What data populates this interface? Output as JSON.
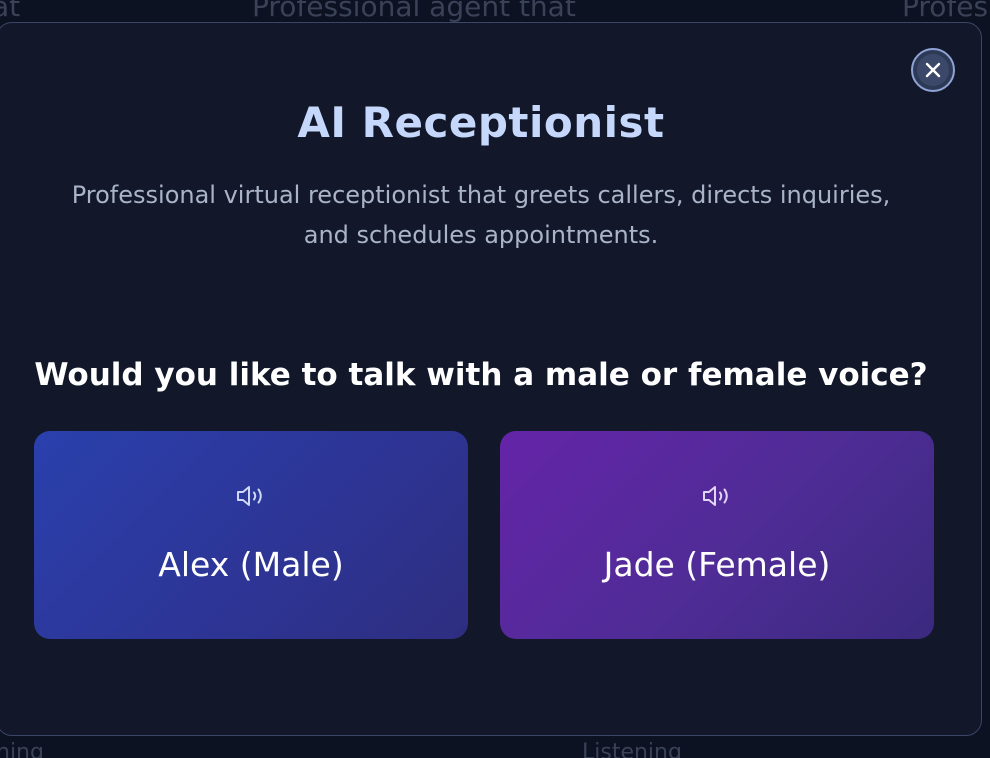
{
  "background": {
    "top_left": "at",
    "top_center": "Professional agent that",
    "top_right": "Profes",
    "bottom_left": "ning",
    "bottom_center": "Listening"
  },
  "modal": {
    "title": "AI Receptionist",
    "description": "Professional virtual receptionist that greets callers, directs inquiries, and schedules appointments.",
    "question": "Would you like to talk with a male or female voice?",
    "close_icon": "close-icon"
  },
  "voices": [
    {
      "label": "Alex (Male)",
      "icon": "speaker-icon",
      "color": "#2a40ad"
    },
    {
      "label": "Jade (Female)",
      "icon": "speaker-icon",
      "color": "#6424a8"
    }
  ]
}
